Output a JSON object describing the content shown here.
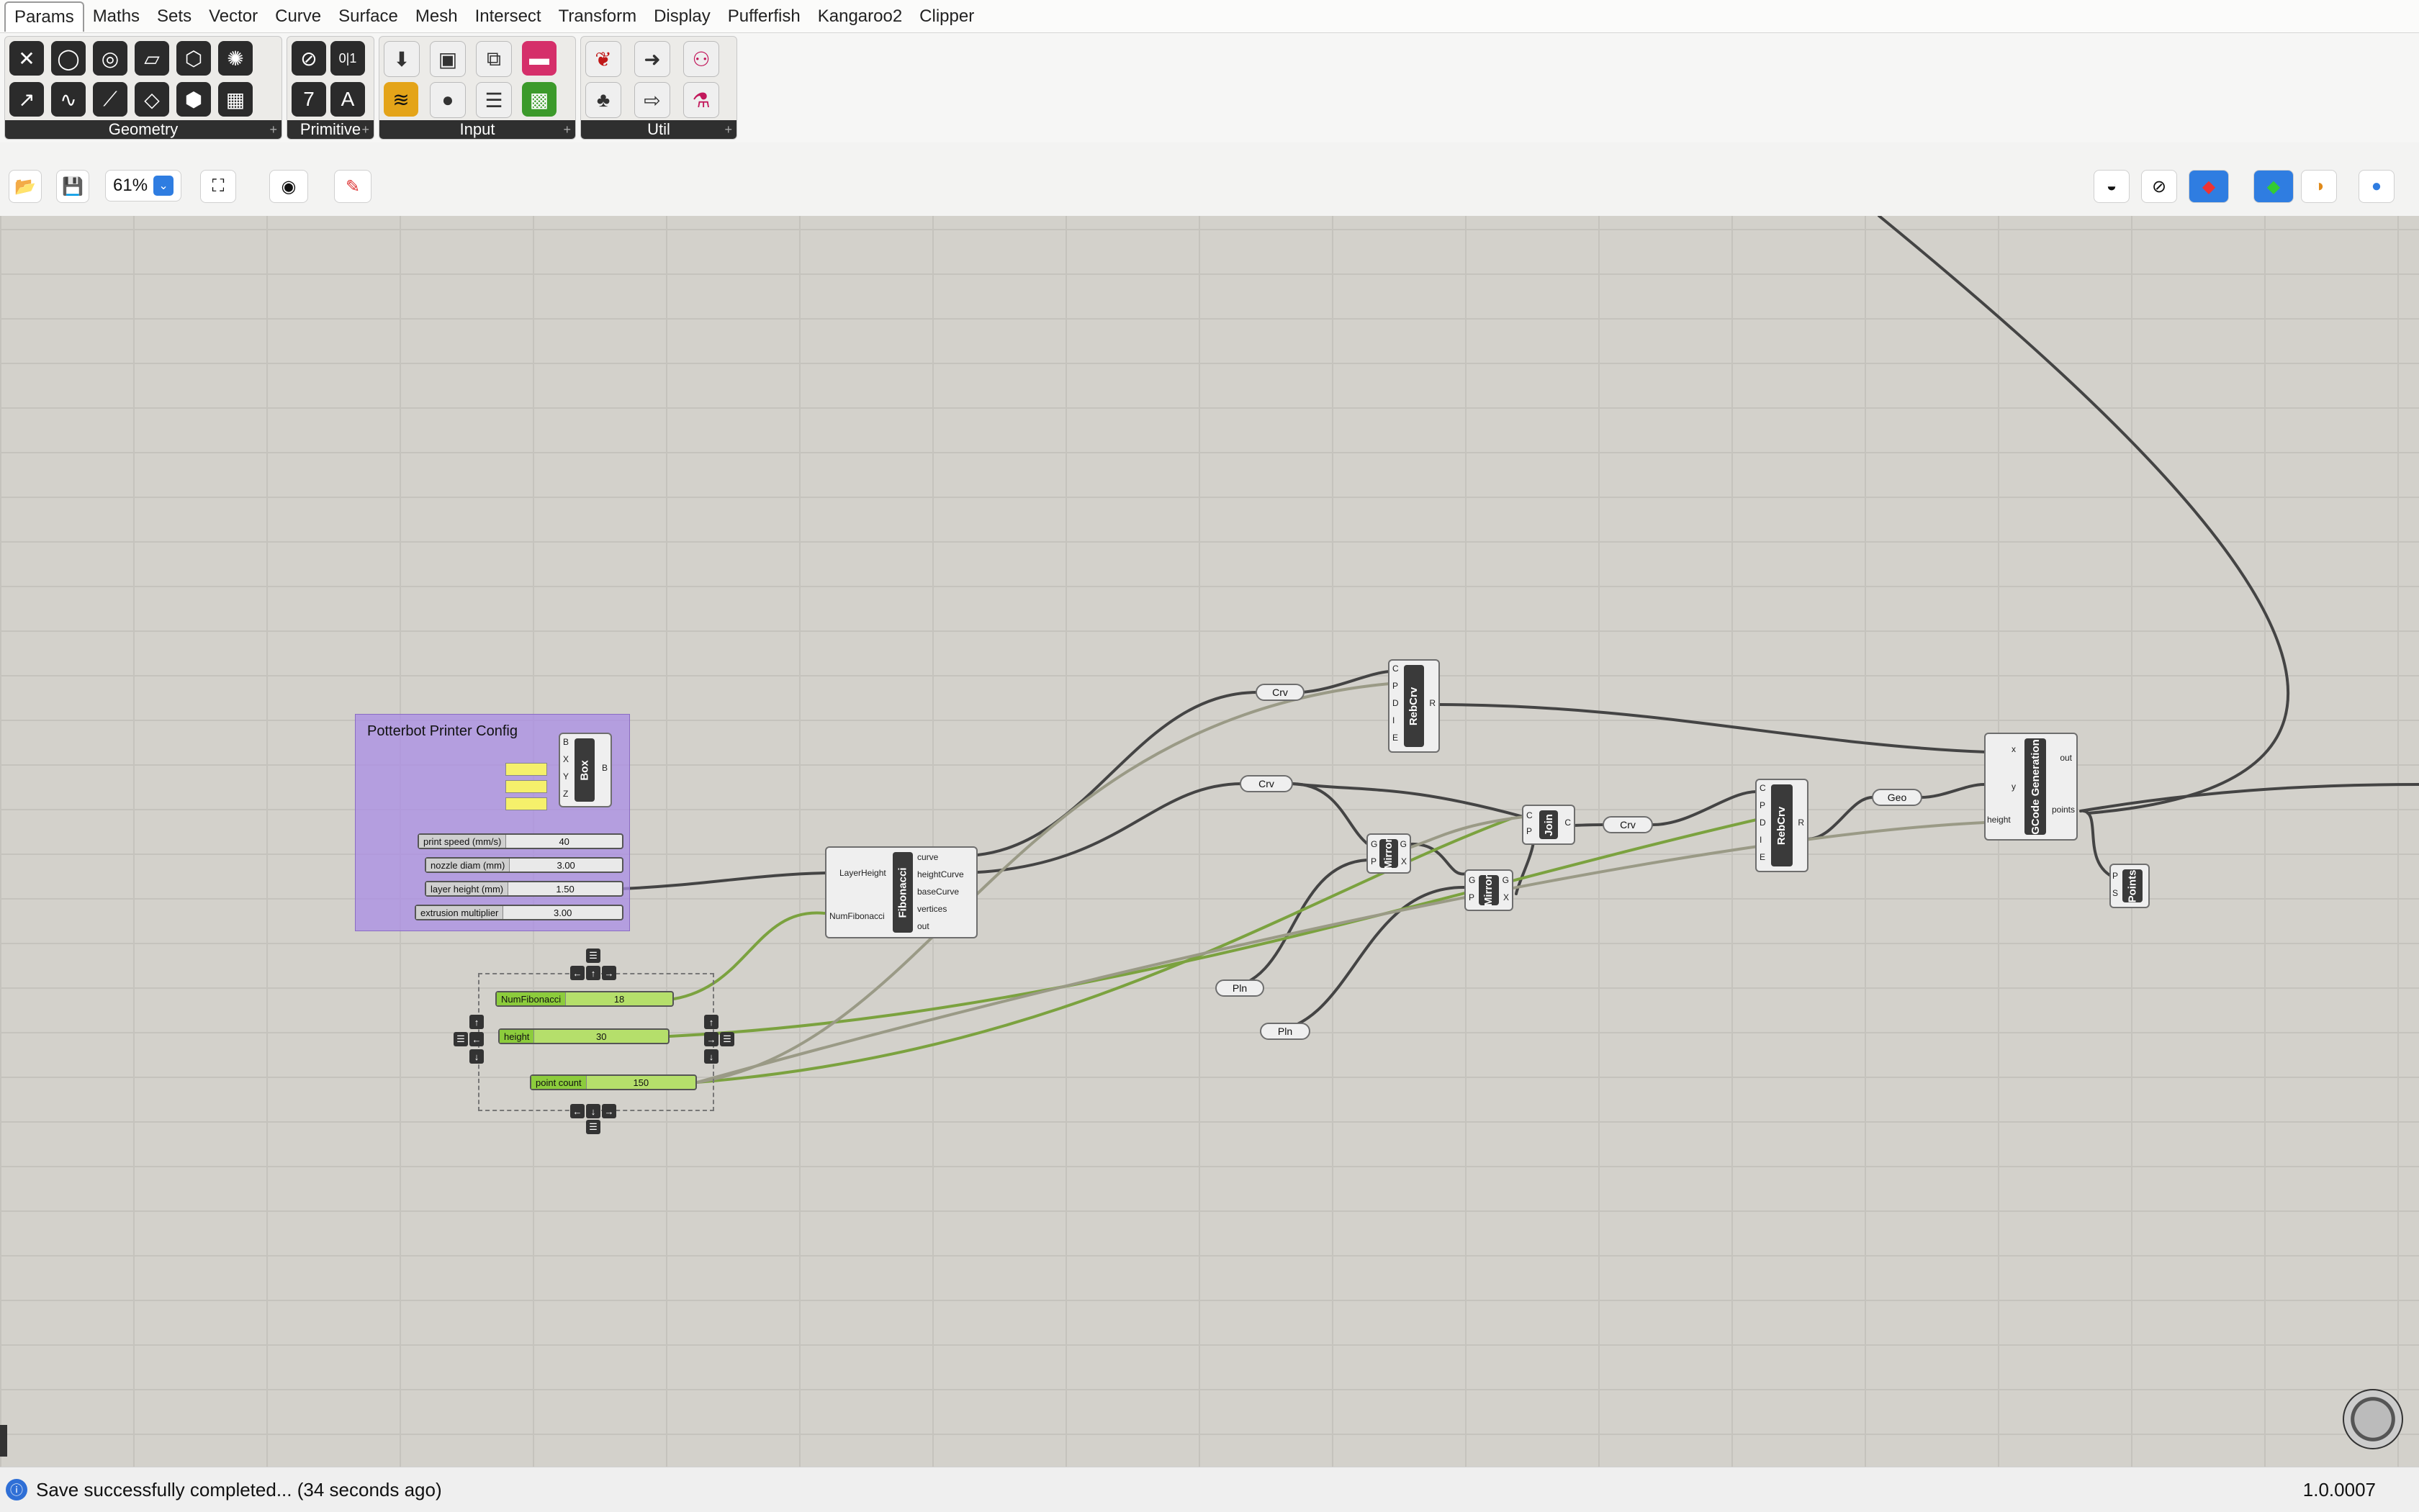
{
  "menu": {
    "tabs": [
      "Params",
      "Maths",
      "Sets",
      "Vector",
      "Curve",
      "Surface",
      "Mesh",
      "Intersect",
      "Transform",
      "Display",
      "Pufferfish",
      "Kangaroo2",
      "Clipper"
    ],
    "active": "Params"
  },
  "ribbon": {
    "groups": [
      "Geometry",
      "Primitive",
      "Input",
      "Util"
    ]
  },
  "primitive_icons": [
    "0|1",
    "7",
    "A"
  ],
  "toolbar": {
    "zoom": "61%"
  },
  "group": {
    "title": "Potterbot Printer Config"
  },
  "config_sliders": [
    {
      "name": "print speed (mm/s)",
      "value": "40"
    },
    {
      "name": "nozzle diam (mm)",
      "value": "3.00"
    },
    {
      "name": "layer height (mm)",
      "value": "1.50"
    },
    {
      "name": "extrusion multiplier",
      "value": "3.00"
    }
  ],
  "green_sliders": [
    {
      "name": "NumFibonacci",
      "value": "18"
    },
    {
      "name": "height",
      "value": "30"
    },
    {
      "name": "point count",
      "value": "150"
    }
  ],
  "components": {
    "box": {
      "name": "Box",
      "inputs": [
        "B",
        "X",
        "Y",
        "Z"
      ],
      "outputs": [
        "B"
      ]
    },
    "fibonacci": {
      "name": "Fibonacci",
      "inputs": [
        "LayerHeight",
        "NumFibonacci"
      ],
      "outputs": [
        "curve",
        "heightCurve",
        "baseCurve",
        "vertices",
        "out"
      ]
    },
    "rebcrv1": {
      "name": "RebCrv",
      "inputs": [
        "C",
        "P",
        "D",
        "I",
        "E"
      ],
      "outputs": [
        "R"
      ]
    },
    "mirror1": {
      "name": "Mirror",
      "inputs": [
        "G",
        "P"
      ],
      "outputs": [
        "G",
        "X"
      ]
    },
    "mirror2": {
      "name": "Mirror",
      "inputs": [
        "G",
        "P"
      ],
      "outputs": [
        "G",
        "X"
      ]
    },
    "join": {
      "name": "Join",
      "inputs": [
        "C",
        "P"
      ],
      "outputs": [
        "C"
      ]
    },
    "rebcrv2": {
      "name": "RebCrv",
      "inputs": [
        "C",
        "P",
        "D",
        "I",
        "E"
      ],
      "outputs": [
        "R"
      ]
    },
    "gcode": {
      "name": "GCode Generation",
      "inputs": [
        "x",
        "y",
        "height"
      ],
      "outputs": [
        "out",
        "points"
      ]
    },
    "points": {
      "name": "Points",
      "inputs": [
        "P",
        "S"
      ]
    }
  },
  "params": {
    "crv1": "Crv",
    "crv2": "Crv",
    "crv3": "Crv",
    "geo": "Geo",
    "pln1": "Pln",
    "pln2": "Pln"
  },
  "status": {
    "message": "Save successfully completed... (34 seconds ago)",
    "version": "1.0.0007"
  }
}
